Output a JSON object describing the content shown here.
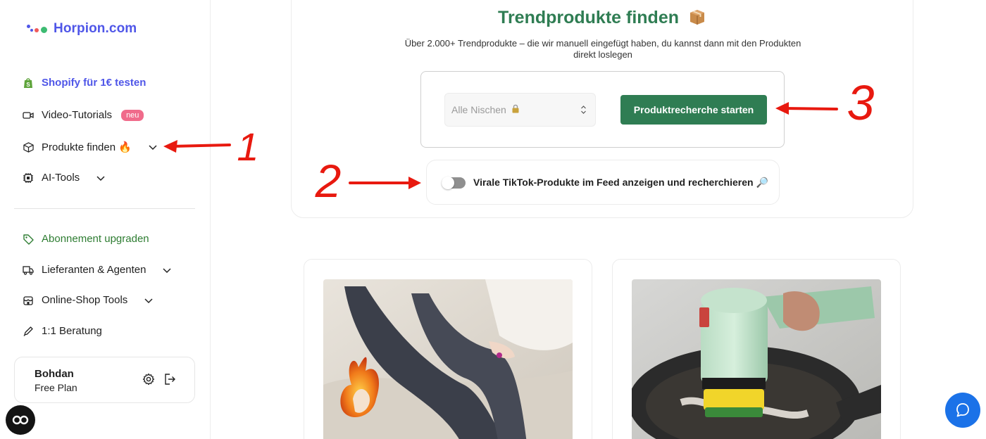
{
  "brand": {
    "name": "Horpion.com"
  },
  "sidebar": {
    "items": [
      {
        "label": "Shopify für 1€ testen",
        "icon": "shopify-bag-icon"
      },
      {
        "label": "Video-Tutorials",
        "badge": "neu",
        "icon": "video-camera-icon"
      },
      {
        "label": "Produkte finden 🔥",
        "icon": "package-icon"
      },
      {
        "label": "AI-Tools",
        "icon": "ai-chip-icon"
      },
      {
        "label": "Abonnement upgraden",
        "icon": "tag-icon"
      },
      {
        "label": "Lieferanten & Agenten",
        "icon": "truck-icon"
      },
      {
        "label": "Online-Shop Tools",
        "icon": "shop-icon"
      },
      {
        "label": "1:1 Beratung",
        "icon": "pencil-icon"
      }
    ]
  },
  "user": {
    "name": "Bohdan",
    "plan": "Free Plan"
  },
  "main": {
    "title": "Trendprodukte finden",
    "subtitle": "Über 2.000+ Trendprodukte – die wir manuell eingefügt haben, du kannst dann mit den Produkten direkt loslegen",
    "niche_select": {
      "value": "Alle Nischen"
    },
    "start_button": "Produktrecherche starten",
    "toggle_label": "Virale TikTok-Produkte im Feed anzeigen und recherchieren 🔎",
    "toggle_on": false
  },
  "annotations": {
    "one": "1",
    "two": "2",
    "three": "3"
  },
  "colors": {
    "brand": "#4f56e8",
    "green": "#2f7d53",
    "arrow": "#e8190f",
    "badge": "#f06b8b",
    "chat": "#1b72e8"
  }
}
